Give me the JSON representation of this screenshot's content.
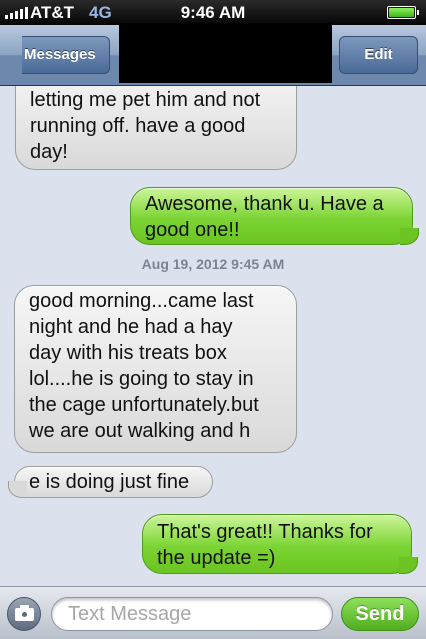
{
  "status_bar": {
    "carrier": "AT&T",
    "network": "4G",
    "time": "9:46 AM",
    "battery_level": 1.0,
    "signal_bars": 5
  },
  "nav": {
    "back_label": "Messages",
    "edit_label": "Edit"
  },
  "messages": [
    {
      "direction": "incoming",
      "text": "letting me pet him and not\nrunning off. have a good\nday!"
    },
    {
      "direction": "outgoing",
      "text": "Awesome, thank u. Have a\ngood one!!"
    },
    {
      "direction": "incoming",
      "text": "good morning...came last\nnight and he had a hay\nday with his treats box\nlol....he is going to stay in\nthe cage unfortunately.but\nwe are out walking and h"
    },
    {
      "direction": "incoming",
      "text": "e is doing just fine"
    },
    {
      "direction": "outgoing",
      "text": "That's great!!  Thanks for\nthe update =)"
    }
  ],
  "timestamp": "Aug 19, 2012 9:45 AM",
  "composer": {
    "placeholder": "Text Message",
    "value": "",
    "send_label": "Send"
  },
  "colors": {
    "outgoing_bubble": "#7bd433",
    "incoming_bubble": "#e9e9e9",
    "background": "#dbe2ed",
    "nav_bar": "#6d88ad"
  },
  "icons": {
    "camera": "camera-icon",
    "battery": "battery-icon",
    "signal": "signal-icon"
  }
}
